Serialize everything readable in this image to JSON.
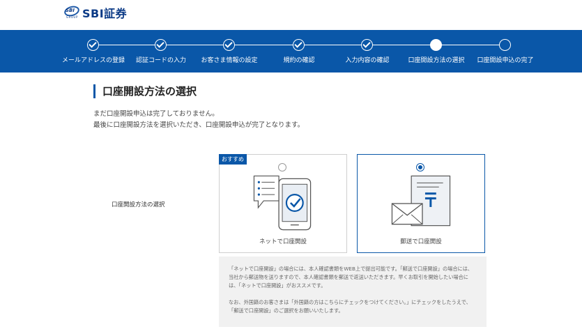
{
  "header": {
    "brand": "SBI証券",
    "logo_mark": "SBI",
    "logo_group": "GROUP"
  },
  "steps": [
    {
      "label": "メールアドレスの登録",
      "state": "done"
    },
    {
      "label": "認証コードの入力",
      "state": "done"
    },
    {
      "label": "お客さま情報の設定",
      "state": "done"
    },
    {
      "label": "規約の確認",
      "state": "done"
    },
    {
      "label": "入力内容の確認",
      "state": "done"
    },
    {
      "label": "口座開設方法の選択",
      "state": "current"
    },
    {
      "label": "口座開設申込の完了",
      "state": "todo"
    }
  ],
  "main": {
    "title": "口座開設方法の選択",
    "intro_line1": "まだ口座開設申込は完了しておりません。",
    "intro_line2": "最後に口座開設方法を選択いただき、口座開設申込が完了となります。",
    "row_label": "口座開設方法の選択"
  },
  "options": {
    "net": {
      "badge": "おすすめ",
      "label": "ネットで口座開設",
      "selected": false,
      "icon": "smartphone-check-icon"
    },
    "mail": {
      "label": "郵送で口座開設",
      "selected": true,
      "icon": "mail-document-icon"
    }
  },
  "notes": {
    "p1": "「ネットで口座開設」の場合には、本人確認書類をWEB上で提出可能です。「郵送で口座開設」の場合には、当社から郵送物を送りますので、本人確認書類を郵送で返送いただきます。早くお取引を開始したい場合には、「ネットで口座開設」がおススメです。",
    "p2": "なお、外国籍のお客さまは「外国籍の方はこちらにチェックをつけてください。」にチェックをしたうえで、「郵送で口座開設」のご選択をお願いいたします。"
  },
  "colors": {
    "brand": "#0a57a8",
    "note_bg": "#f1f1f1"
  }
}
